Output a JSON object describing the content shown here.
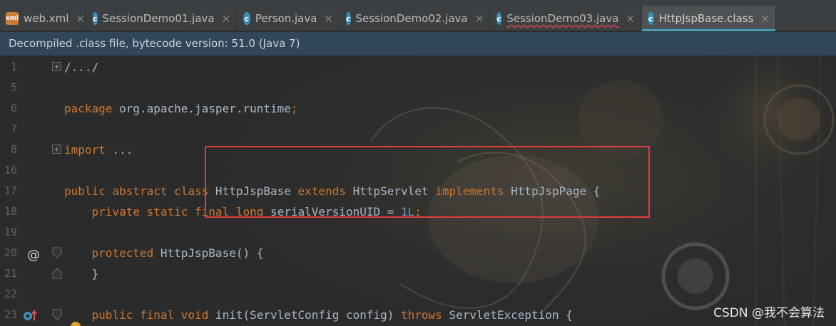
{
  "tabs": [
    {
      "label": "web.xml",
      "icon": "xml-file-icon",
      "active": false
    },
    {
      "label": "SessionDemo01.java",
      "icon": "java-class-icon",
      "active": false
    },
    {
      "label": "Person.java",
      "icon": "java-class-icon",
      "active": false
    },
    {
      "label": "SessionDemo02.java",
      "icon": "java-class-icon",
      "active": false
    },
    {
      "label": "SessionDemo03.java",
      "icon": "java-class-icon",
      "active": false,
      "error": true
    },
    {
      "label": "HttpJspBase.class",
      "icon": "decompiled-class-icon",
      "active": true
    }
  ],
  "tab_icon_letter": "c",
  "tab_xml_letter": "xml",
  "close_glyph": "×",
  "banner": {
    "text": "Decompiled .class file, bytecode version: 51.0 (Java 7)"
  },
  "editor": {
    "line_numbers": [
      "1",
      "5",
      "6",
      "7",
      "8",
      "16",
      "17",
      "18",
      "19",
      "20",
      "21",
      "22",
      "23"
    ],
    "line1": "/.../",
    "line6_kw": "package",
    "line6_rest": " org.apache.jasper.runtime",
    "line6_semi": ";",
    "line8_kw": "import",
    "line8_rest": " ...",
    "line17": {
      "kw1": "public abstract class",
      "name": " HttpJspBase ",
      "kw2": "extends",
      "parent": " HttpServlet ",
      "kw3": "implements",
      "iface": " HttpJspPage {"
    },
    "line18": {
      "kw": "    private static final long",
      "name": " serialVersionUID = ",
      "num": "1L",
      "semi": ";"
    },
    "line20": {
      "kw": "    protected",
      "rest": " HttpJspBase() {"
    },
    "line21": "    }",
    "line23": {
      "kw": "    public final void",
      "rest": " init(ServletConfig config) ",
      "kw2": "throws",
      "rest2": " ServletException {"
    },
    "at_symbol": "@",
    "fold_plus": "+"
  },
  "colors": {
    "keyword": "#cc7832",
    "number": "#6897bb",
    "text": "#a9b7c6",
    "highlight_box": "#e03c3c",
    "banner_bg": "#32465a"
  },
  "watermark": "CSDN @我不会算法"
}
